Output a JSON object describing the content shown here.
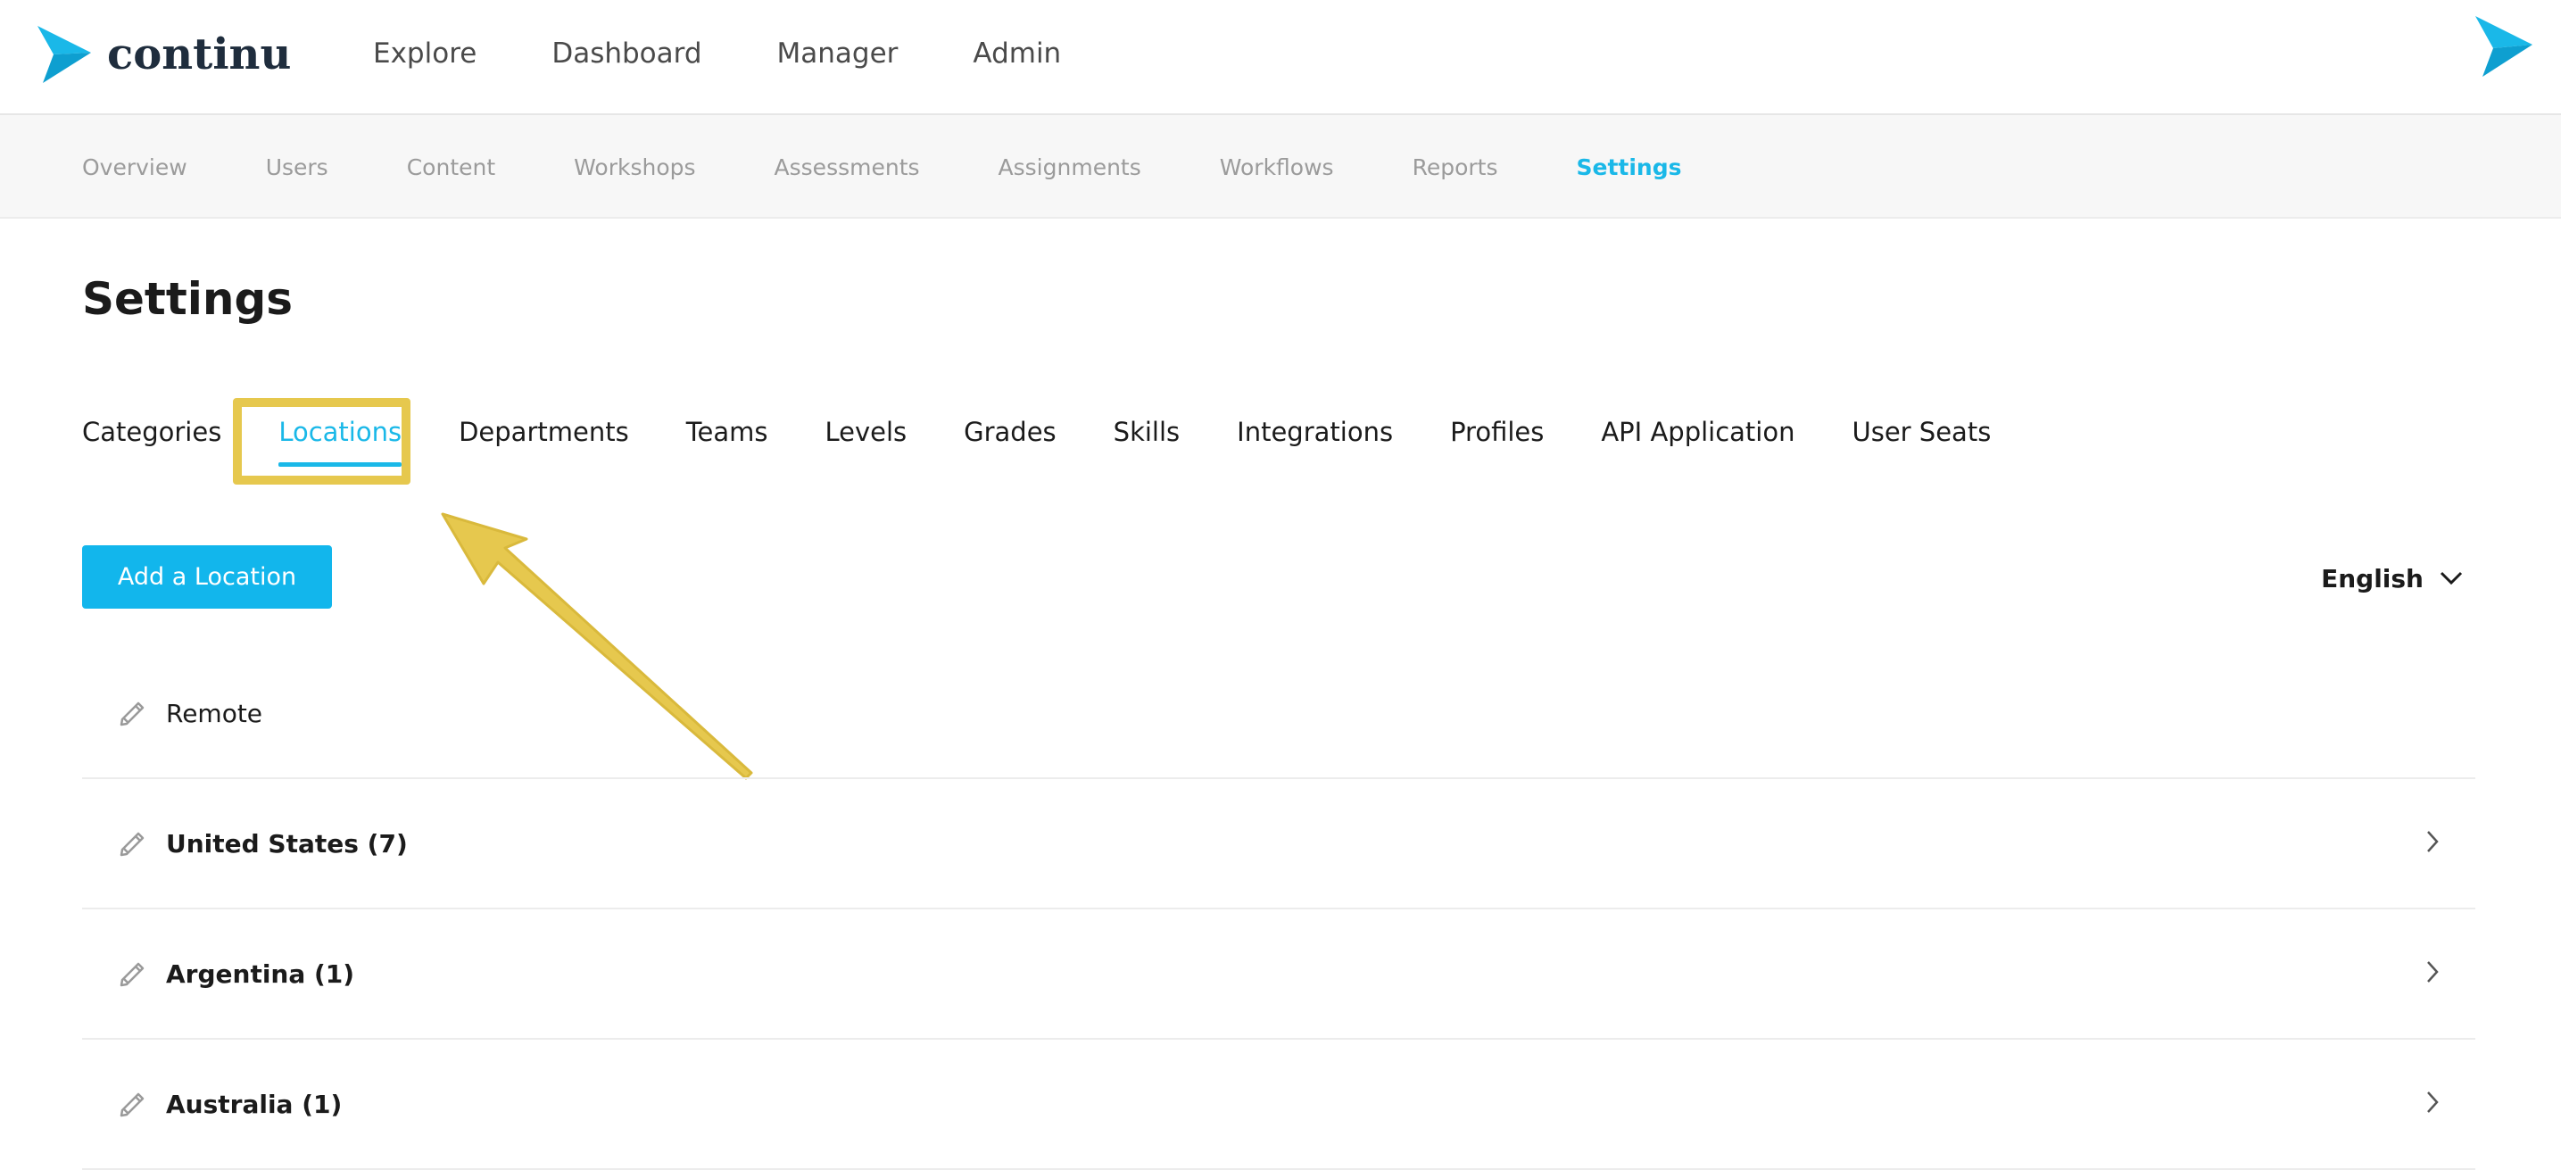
{
  "app": {
    "brand": "continu"
  },
  "main_nav": [
    {
      "label": "Explore"
    },
    {
      "label": "Dashboard"
    },
    {
      "label": "Manager"
    },
    {
      "label": "Admin"
    }
  ],
  "sub_nav": [
    {
      "label": "Overview",
      "active": false
    },
    {
      "label": "Users",
      "active": false
    },
    {
      "label": "Content",
      "active": false
    },
    {
      "label": "Workshops",
      "active": false
    },
    {
      "label": "Assessments",
      "active": false
    },
    {
      "label": "Assignments",
      "active": false
    },
    {
      "label": "Workflows",
      "active": false
    },
    {
      "label": "Reports",
      "active": false
    },
    {
      "label": "Settings",
      "active": true
    }
  ],
  "page": {
    "title": "Settings"
  },
  "settings_tabs": [
    {
      "label": "Categories",
      "active": false
    },
    {
      "label": "Locations",
      "active": true
    },
    {
      "label": "Departments",
      "active": false
    },
    {
      "label": "Teams",
      "active": false
    },
    {
      "label": "Levels",
      "active": false
    },
    {
      "label": "Grades",
      "active": false
    },
    {
      "label": "Skills",
      "active": false
    },
    {
      "label": "Integrations",
      "active": false
    },
    {
      "label": "Profiles",
      "active": false
    },
    {
      "label": "API Application",
      "active": false
    },
    {
      "label": "User Seats",
      "active": false
    }
  ],
  "actions": {
    "add_location_label": "Add a Location",
    "language": "English"
  },
  "locations": [
    {
      "name": "Remote",
      "bold": false,
      "expandable": false
    },
    {
      "name": "United States (7)",
      "bold": true,
      "expandable": true
    },
    {
      "name": "Argentina (1)",
      "bold": true,
      "expandable": true
    },
    {
      "name": "Australia (1)",
      "bold": true,
      "expandable": true
    }
  ],
  "colors": {
    "accent": "#12b6ec",
    "highlight": "#e6c84e",
    "brand_dark": "#1f2d3d"
  },
  "icons": {
    "edit": "pencil-icon",
    "expand": "chevron-right-icon",
    "language_dropdown": "chevron-down-icon"
  }
}
